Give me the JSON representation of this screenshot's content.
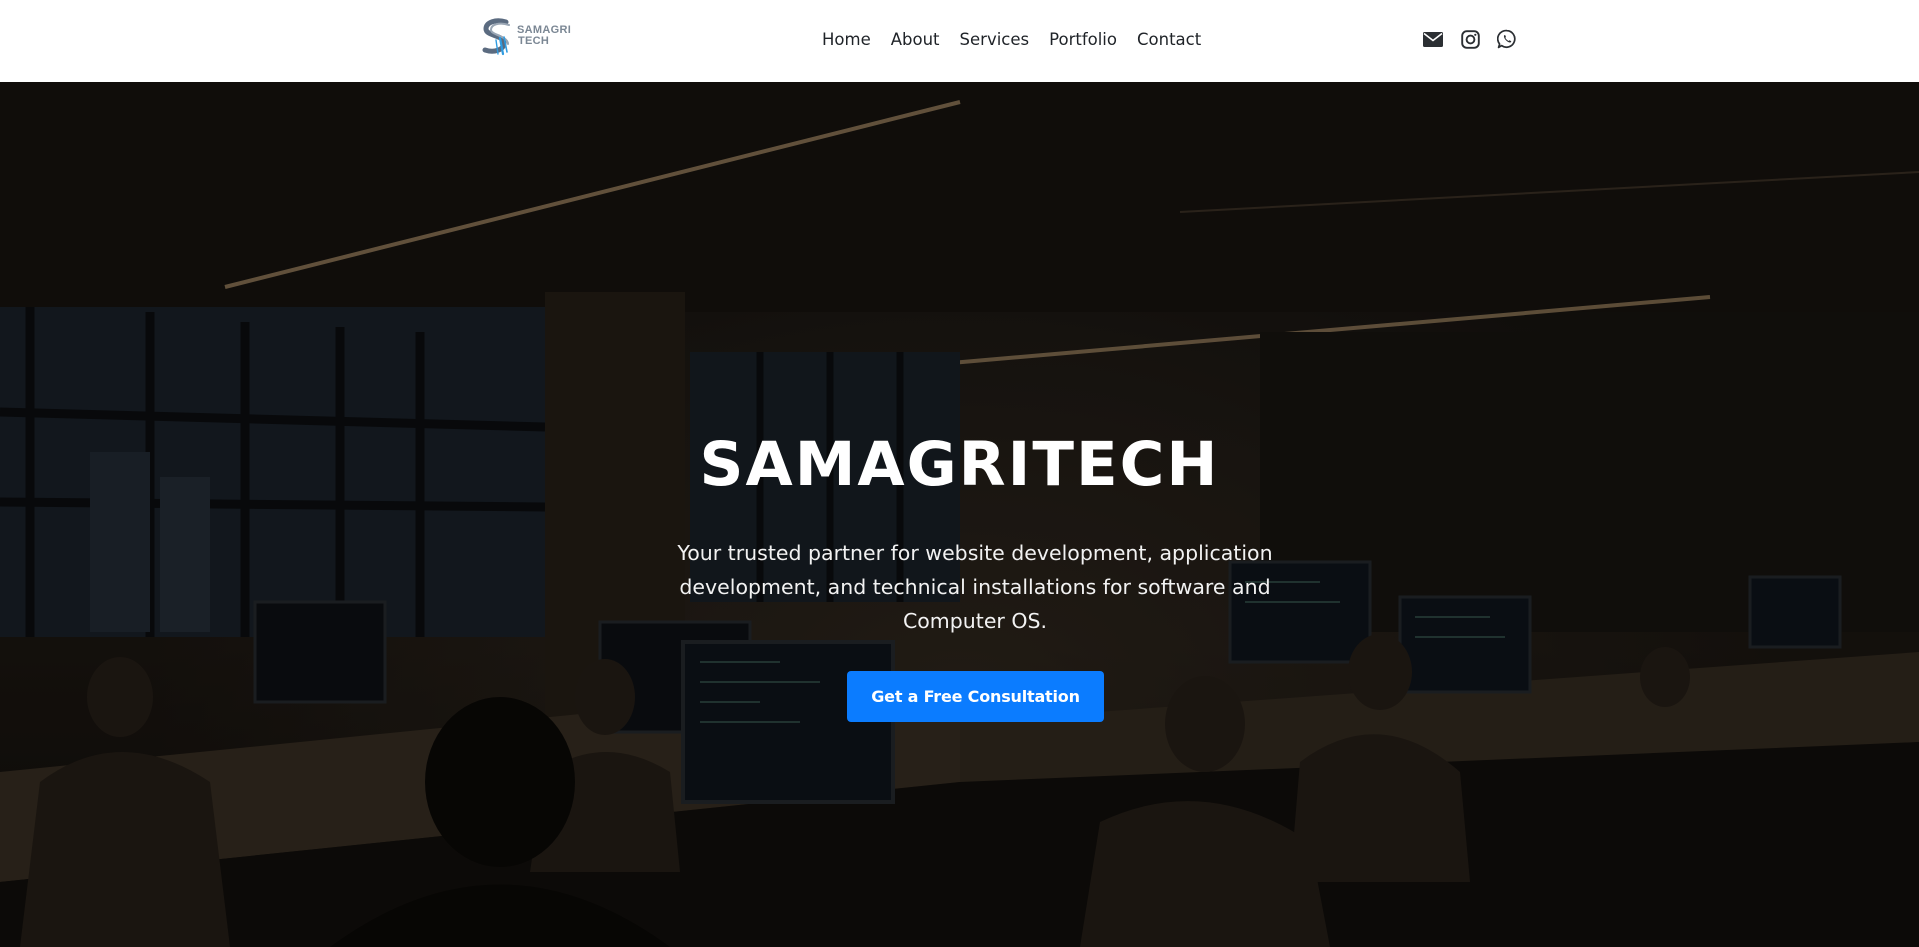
{
  "brand": {
    "logo_line1": "SAMAGRI",
    "logo_line2": "TECH",
    "logo_color": "#7b8794"
  },
  "nav": {
    "items": [
      {
        "label": "Home"
      },
      {
        "label": "About"
      },
      {
        "label": "Services"
      },
      {
        "label": "Portfolio"
      },
      {
        "label": "Contact"
      }
    ]
  },
  "socials": [
    {
      "icon": "envelope-icon"
    },
    {
      "icon": "instagram-icon"
    },
    {
      "icon": "whatsapp-icon"
    }
  ],
  "hero": {
    "title": "SAMAGRITECH",
    "subtitle": "Your trusted partner for website development, application development, and technical installations for software and Computer OS.",
    "cta_label": "Get a Free Consultation",
    "cta_color": "#0b7cff"
  }
}
